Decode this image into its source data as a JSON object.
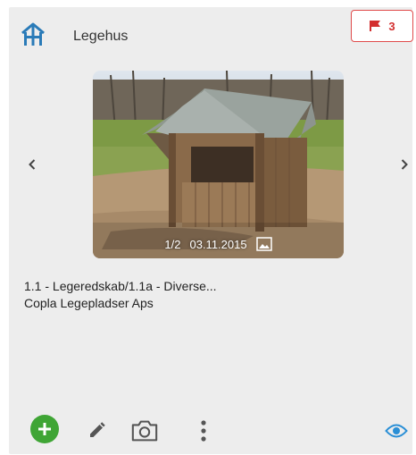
{
  "header": {
    "title": "Legehus",
    "icon": "playhouse-icon",
    "accent_color": "#2a7bb8"
  },
  "flag": {
    "icon": "flag-icon",
    "count": "3",
    "color": "#d32f2f"
  },
  "photo": {
    "counter": "1/2",
    "date": "03.11.2015",
    "icon": "image-icon"
  },
  "info": {
    "line1": "1.1 - Legeredskab/1.1a - Diverse...",
    "line2": "Copla Legepladser Aps"
  },
  "toolbar": {
    "add_icon": "plus-circle-icon",
    "add_color": "#3fa535",
    "edit_icon": "pencil-icon",
    "camera_icon": "camera-icon",
    "more_icon": "more-vertical-icon",
    "view_icon": "eye-icon",
    "view_color": "#2a8fd6"
  }
}
